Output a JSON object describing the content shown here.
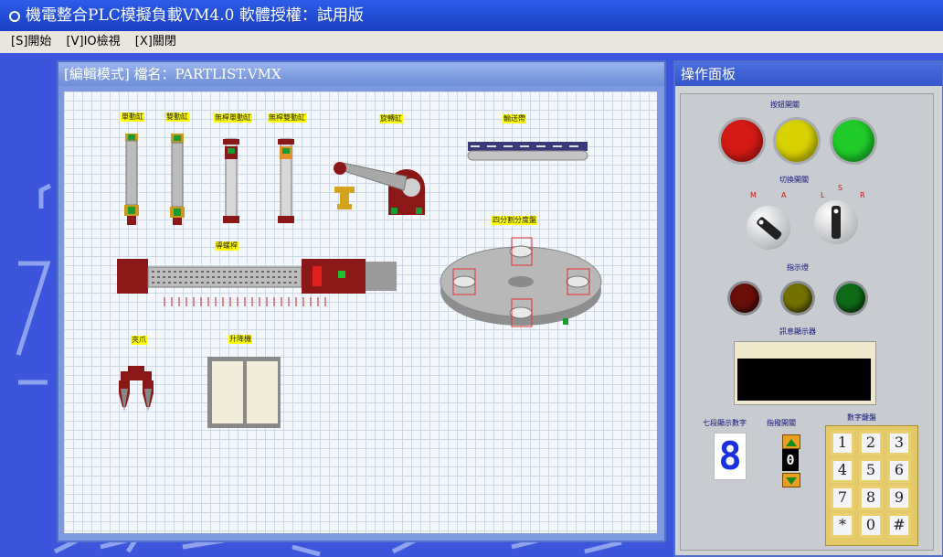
{
  "app": {
    "title": "機電整合PLC模擬負載VM4.0  軟體授權：試用版"
  },
  "menu": [
    {
      "label": "[S]開始"
    },
    {
      "label": "[V]IO檢視"
    },
    {
      "label": "[X]關閉"
    }
  ],
  "editor": {
    "title": "[編輯模式]    檔名：PARTLIST.VMX",
    "components": {
      "single_cyl": "單動缸",
      "double_cyl": "雙動缸",
      "rodless_single": "無桿單動缸",
      "rodless_double": "無桿雙動缸",
      "rotary_cyl": "旋轉缸",
      "conveyor": "輸送帶",
      "indexer": "四分割分度盤",
      "lead_screw": "導螺桿",
      "gripper": "夾爪",
      "elevator": "升降機"
    }
  },
  "panel": {
    "title": "操作面板",
    "push_buttons_label": "按鈕開關",
    "selector_label": "切換開關",
    "selector_marks": {
      "m": "M",
      "a": "A",
      "l": "L",
      "s": "S",
      "r": "R"
    },
    "indicator_label": "指示燈",
    "message_label": "訊息顯示器",
    "seven_seg_label": "七段顯示數字",
    "thumbwheel_label": "指撥開關",
    "seven_seg_value": "8",
    "thumbwheel_value": "0",
    "keypad_label": "數字鍵盤",
    "keys": [
      "1",
      "2",
      "3",
      "4",
      "5",
      "6",
      "7",
      "8",
      "9",
      "*",
      "0",
      "#"
    ]
  },
  "colors": {
    "btn_red": "#d41a14",
    "btn_yellow": "#d8d200",
    "btn_green": "#1fcc2a",
    "lamp_red": "#6a0e08",
    "lamp_yellow": "#747000",
    "lamp_green": "#0e6a16"
  }
}
